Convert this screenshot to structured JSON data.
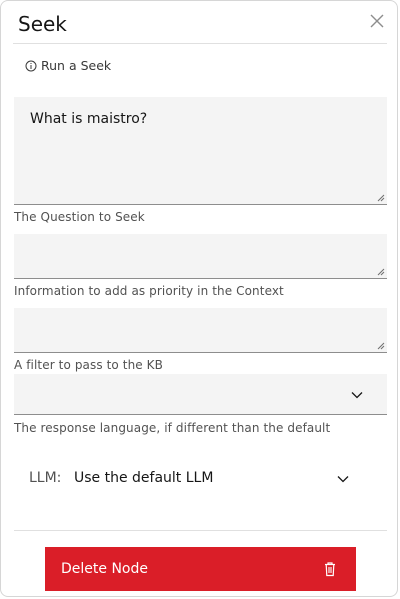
{
  "panel": {
    "title": "Seek",
    "subtitle": "Run a Seek"
  },
  "fields": {
    "question": {
      "value": "What is maistro?",
      "helper": "The Question to Seek"
    },
    "context": {
      "value": "",
      "helper": "Information to add as priority in the Context"
    },
    "filter": {
      "value": "",
      "helper": "A filter to pass to the KB"
    },
    "language": {
      "value": "",
      "helper": "The response language, if different than the default"
    }
  },
  "llm": {
    "label": "LLM:",
    "value": "Use the default LLM"
  },
  "actions": {
    "delete_label": "Delete Node"
  },
  "colors": {
    "danger": "#da1e28",
    "field_bg": "#f4f4f4",
    "helper_text": "#525252"
  },
  "icons": {
    "close": "close-icon",
    "info": "info-icon",
    "chevron": "chevron-down-icon",
    "trash": "trash-icon",
    "resize": "resize-grip-icon"
  }
}
